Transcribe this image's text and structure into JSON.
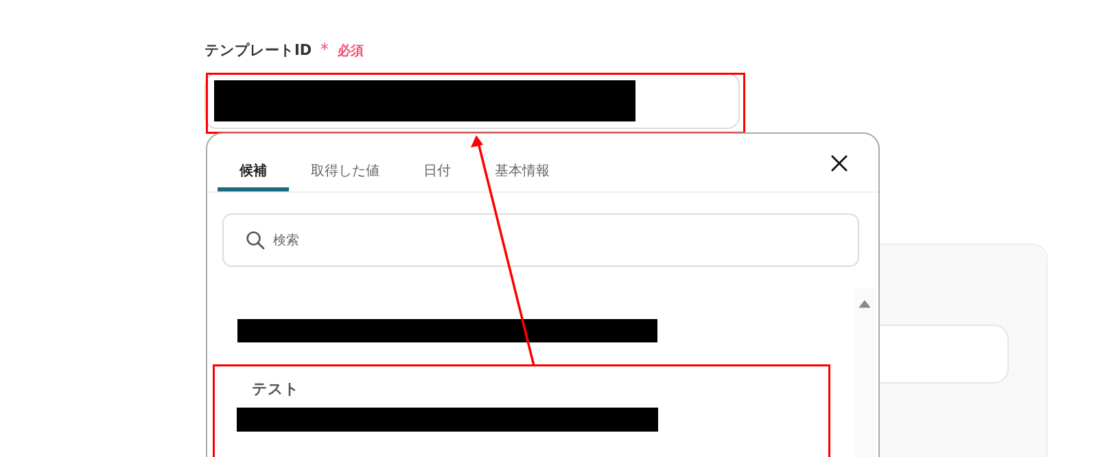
{
  "field": {
    "label": "テンプレートID",
    "required_mark": "＊",
    "required_text": "必須",
    "redacted": true,
    "highlighted": true
  },
  "picker": {
    "tabs": [
      {
        "label": "候補",
        "selected": true
      },
      {
        "label": "取得した値",
        "selected": false
      },
      {
        "label": "日付",
        "selected": false
      },
      {
        "label": "基本情報",
        "selected": false
      }
    ],
    "search": {
      "placeholder": "検索"
    },
    "items": [
      {
        "kind": "redacted",
        "highlighted": false
      },
      {
        "kind": "titled",
        "title": "テスト",
        "highlighted": true
      }
    ]
  },
  "arrow": {
    "shown": true
  }
}
